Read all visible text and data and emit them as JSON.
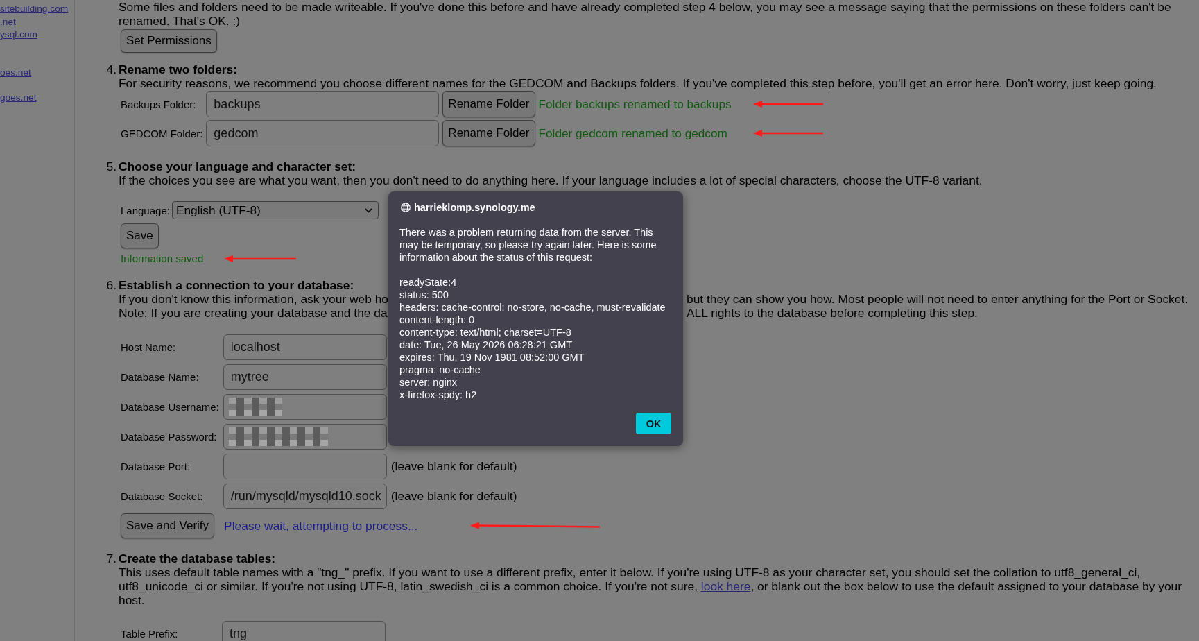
{
  "sidebar": {
    "links": [
      "sitebuilding.com",
      ".net",
      "ysql.com",
      "oes.net",
      "goes.net"
    ]
  },
  "intro": {
    "text": "Some files and folders need to be made writeable. If you've done this before and have already completed step 4 below, you may see a message saying that the permissions on these folders can't be renamed. That's OK. :)",
    "button": "Set Permissions"
  },
  "steps": [
    {
      "number": "4.",
      "kind": "folders",
      "title": "Rename two folders:",
      "description": "For security reasons, we recommend you choose different names for the GEDCOM and Backups folders. If you've completed this step before, you'll get an error here. Don't worry, just keep going.",
      "folders": [
        {
          "label": "Backups Folder:",
          "value": "backups",
          "button": "Rename Folder",
          "message": {
            "text": "Folder backups renamed to backups",
            "kind": "success"
          }
        },
        {
          "label": "GEDCOM Folder:",
          "value": "gedcom",
          "button": "Rename Folder",
          "message": {
            "text": "Folder gedcom renamed to gedcom",
            "kind": "success"
          }
        }
      ]
    },
    {
      "number": "5.",
      "kind": "language",
      "title": "Choose your language and character set:",
      "description": "If the choices you see are what you want, then you don't need to do anything here. If your language includes a lot of special characters, choose the UTF-8 variant.",
      "field": {
        "label": "Language:",
        "value": "English (UTF-8)"
      },
      "button": "Save",
      "message": {
        "text": "Information saved",
        "kind": "success"
      }
    },
    {
      "number": "6.",
      "kind": "database",
      "title": "Establish a connection to your database:",
      "description_lines": [
        {
          "parts": [
            "If you don't know this information, ask your web ho",
            "but they can show you how. Most people will not need to enter anything for the Port or Socket."
          ]
        },
        {
          "parts": [
            "Note: If you are creating your database and the da",
            "ALL rights to the database before completing this step."
          ]
        }
      ],
      "fields": [
        {
          "label": "Host Name:",
          "value": "localhost",
          "redacted": false
        },
        {
          "label": "Database Name:",
          "value": "mytree",
          "redacted": false
        },
        {
          "label": "Database Username:",
          "redacted": true
        },
        {
          "label": "Database Password:",
          "redacted": true
        },
        {
          "label": "Database Port:",
          "redacted": false,
          "hint": "(leave blank for default)"
        },
        {
          "label": "Database Socket:",
          "value": "/run/mysqld/mysqld10.sock",
          "redacted": false,
          "hint": "(leave blank for default)"
        }
      ],
      "button": "Save and Verify",
      "message": {
        "text": "Please wait, attempting to process...",
        "kind": "progress"
      }
    },
    {
      "number": "7.",
      "kind": "tables",
      "title": "Create the database tables:",
      "description_before": "This uses default table names with a \"tng_\" prefix. If you want to use a different prefix, enter it below. If you're using UTF-8 as your character set, you should set the collation to utf8_general_ci, utf8_unicode_ci or similar. If you're not using UTF-8, latin_swedish_ci is a common choice. If you're not sure, ",
      "link": "look here",
      "description_after": ", or blank out the box below to use the default assigned to your database by your host.",
      "fields": [
        {
          "label": "Table Prefix:",
          "value": "tng",
          "redacted": false
        }
      ]
    }
  ],
  "dialog": {
    "title": "harrieklomp.synology.me",
    "message": "There was a problem returning data from the server. This may be temporary, so please try again later. Here is some information about the status of this request:",
    "details": [
      "readyState:4",
      "status: 500",
      "headers: cache-control: no-store, no-cache, must-revalidate",
      "content-length: 0",
      "content-type: text/html; charset=UTF-8",
      "date: Tue, 26 May 2026 06:28:21 GMT",
      "expires: Thu, 19 Nov 1981 08:52:00 GMT",
      "pragma: no-cache",
      "server: nginx",
      "x-firefox-spdy: h2"
    ],
    "button": "OK"
  }
}
